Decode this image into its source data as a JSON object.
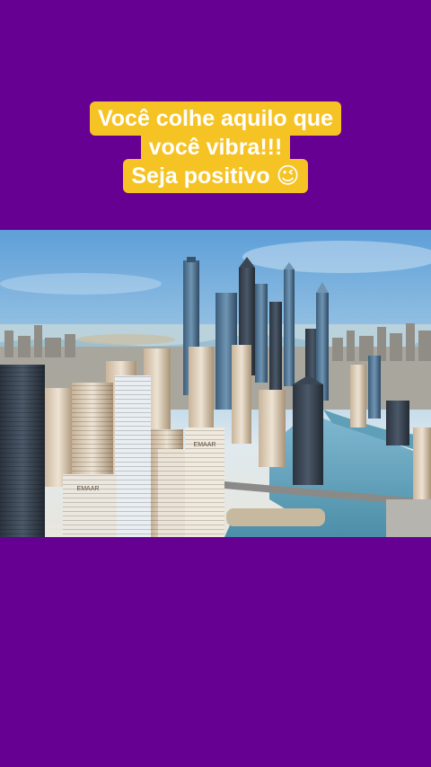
{
  "caption": {
    "lines": [
      "Você colhe aquilo que",
      "você vibra!!!",
      "Seja positivo 😉"
    ]
  },
  "photo": {
    "subject": "aerial city skyline with skyscrapers and marina",
    "signs": [
      "EMAAR",
      "EMAAR"
    ]
  },
  "colors": {
    "background": "#650092",
    "caption_highlight": "#f6c324",
    "caption_text": "#ffffff"
  }
}
